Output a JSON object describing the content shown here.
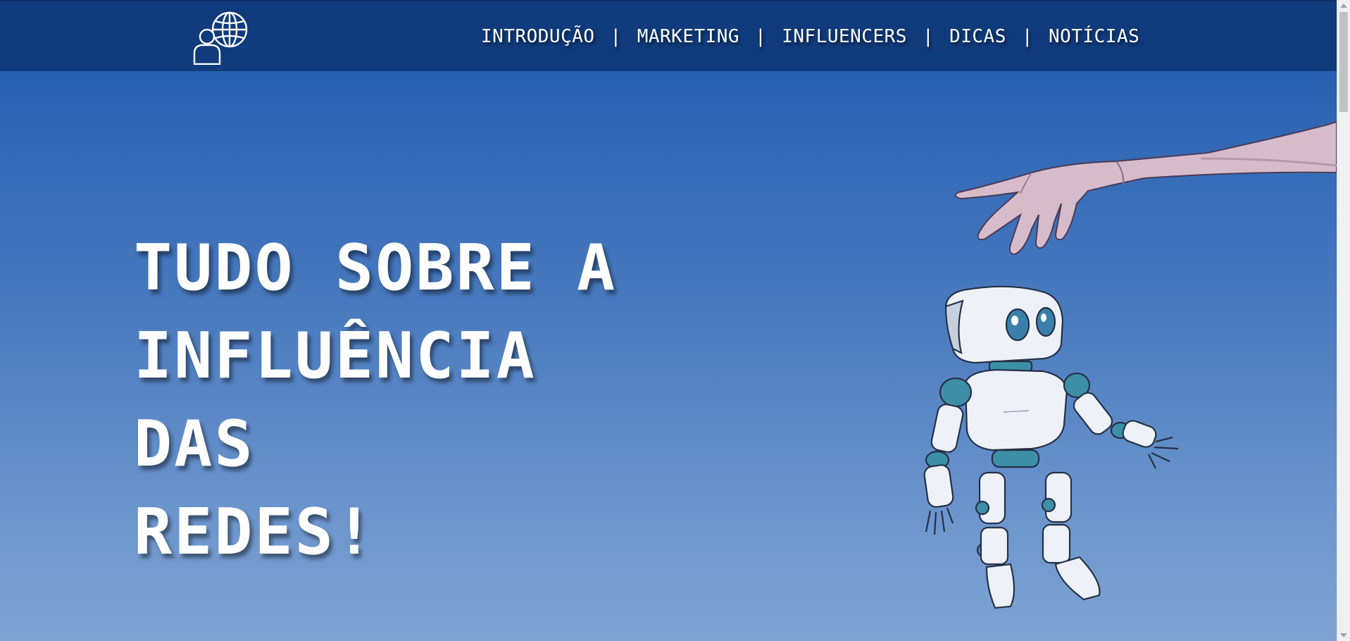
{
  "header": {
    "logo": {
      "icon": "person-globe-icon"
    },
    "nav": [
      {
        "label": "INTRODUÇÃO"
      },
      {
        "label": "MARKETING"
      },
      {
        "label": "INFLUENCERS"
      },
      {
        "label": "DICAS"
      },
      {
        "label": "NOTÍCIAS"
      }
    ],
    "separator": "|"
  },
  "hero": {
    "title_lines": [
      "TUDO SOBRE A",
      "INFLUÊNCIA",
      "DAS",
      "REDES!"
    ],
    "illustration": "hand-holding-robot-marionette-illustration"
  },
  "colors": {
    "header_bg": "#103b7c",
    "gradient_top": "#2159ad",
    "gradient_bottom": "#7ea4d4",
    "text": "#ffffff"
  }
}
